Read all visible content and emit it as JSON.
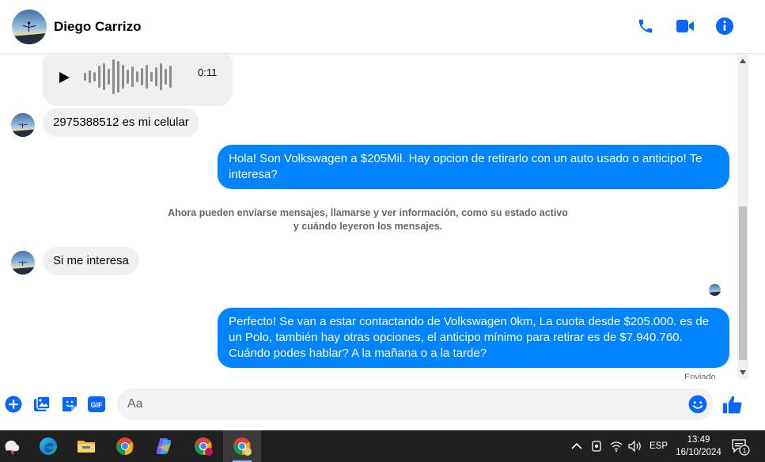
{
  "contact": {
    "name": "Diego Carrizo"
  },
  "header_icons": [
    "phone-icon",
    "video-camera-icon",
    "info-icon"
  ],
  "colors": {
    "accent": "#0084ff",
    "messenger_blue": "#0866ff",
    "incoming_bubble": "#f0f0f0",
    "system_text": "#65676b"
  },
  "messages": {
    "audio": {
      "duration": "0:11"
    },
    "incoming_1": "2975388512 es mi celular",
    "outgoing_1": "Hola! Son Volkswagen a $205Mil. Hay opcion de retirarlo con un auto usado o anticipo! Te interesa?",
    "system": "Ahora pueden enviarse mensajes, llamarse y ver información, como su estado activo y cuándo leyeron los mensajes.",
    "incoming_2": "Si me interesa",
    "outgoing_2": "Perfecto!  Se van a estar contactando de Volkswagen 0km, La cuota desde $205.000. es de un Polo, también hay otras opciones, el anticipo mínimo para retirar es de $7.940.760. Cuándo podes hablar? A la mañana o a la tarde?",
    "status": "Enviado"
  },
  "composer": {
    "placeholder": "Aa",
    "icons": [
      "add-icon",
      "photo-icon",
      "sticker-icon",
      "gif-icon",
      "emoji-icon",
      "thumbs-up-icon"
    ],
    "gif_label": "GIF"
  },
  "taskbar": {
    "apps": [
      "weather-icon",
      "edge-icon",
      "file-explorer-icon",
      "chrome-icon",
      "copilot-icon",
      "chrome-profile-icon",
      "chrome-profile-active-icon"
    ],
    "language": "ESP",
    "time": "13:49",
    "date": "16/10/2024",
    "notification_count": "1"
  }
}
